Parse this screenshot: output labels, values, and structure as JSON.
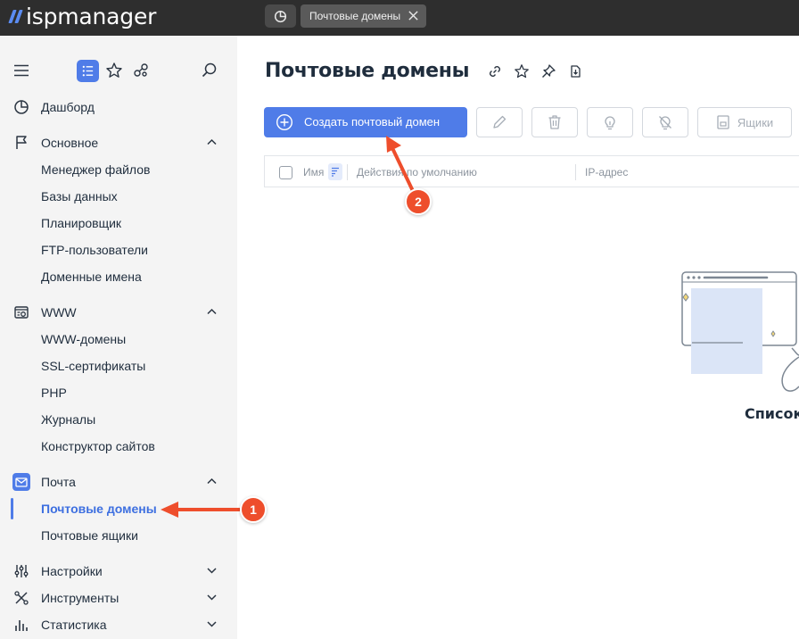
{
  "app": {
    "logo_text": "ispmanager",
    "active_tab": "Почтовые домены"
  },
  "sidebar": {
    "sections": [
      {
        "label": "Дашборд",
        "icon": "dashboard-icon"
      },
      {
        "label": "Основное",
        "icon": "flag-icon",
        "expanded": true,
        "items": [
          "Менеджер файлов",
          "Базы данных",
          "Планировщик",
          "FTP-пользователи",
          "Доменные имена"
        ]
      },
      {
        "label": "WWW",
        "icon": "www-settings-icon",
        "expanded": true,
        "items": [
          "WWW-домены",
          "SSL-сертификаты",
          "PHP",
          "Журналы",
          "Конструктор сайтов"
        ]
      },
      {
        "label": "Почта",
        "icon": "mail-icon",
        "expanded": true,
        "items": [
          "Почтовые домены",
          "Почтовые ящики"
        ]
      },
      {
        "label": "Настройки",
        "icon": "sliders-icon",
        "expanded": false
      },
      {
        "label": "Инструменты",
        "icon": "tools-icon",
        "expanded": false
      },
      {
        "label": "Статистика",
        "icon": "stats-icon",
        "expanded": false
      }
    ],
    "active_item": "Почтовые домены"
  },
  "main": {
    "title": "Почтовые домены",
    "toolbar": {
      "create_label": "Создать почтовый домен",
      "mailboxes_label": "Ящики"
    },
    "table": {
      "columns": [
        "Имя",
        "Действия по умолчанию",
        "IP-адрес"
      ]
    },
    "empty_text": "Список"
  },
  "annotations": {
    "badge_1": "1",
    "badge_2": "2",
    "color": "#ee4e2c"
  },
  "colors": {
    "accent": "#4f7ce8",
    "topbar": "#2e2e2e",
    "sidebar": "#f4f4f4"
  }
}
